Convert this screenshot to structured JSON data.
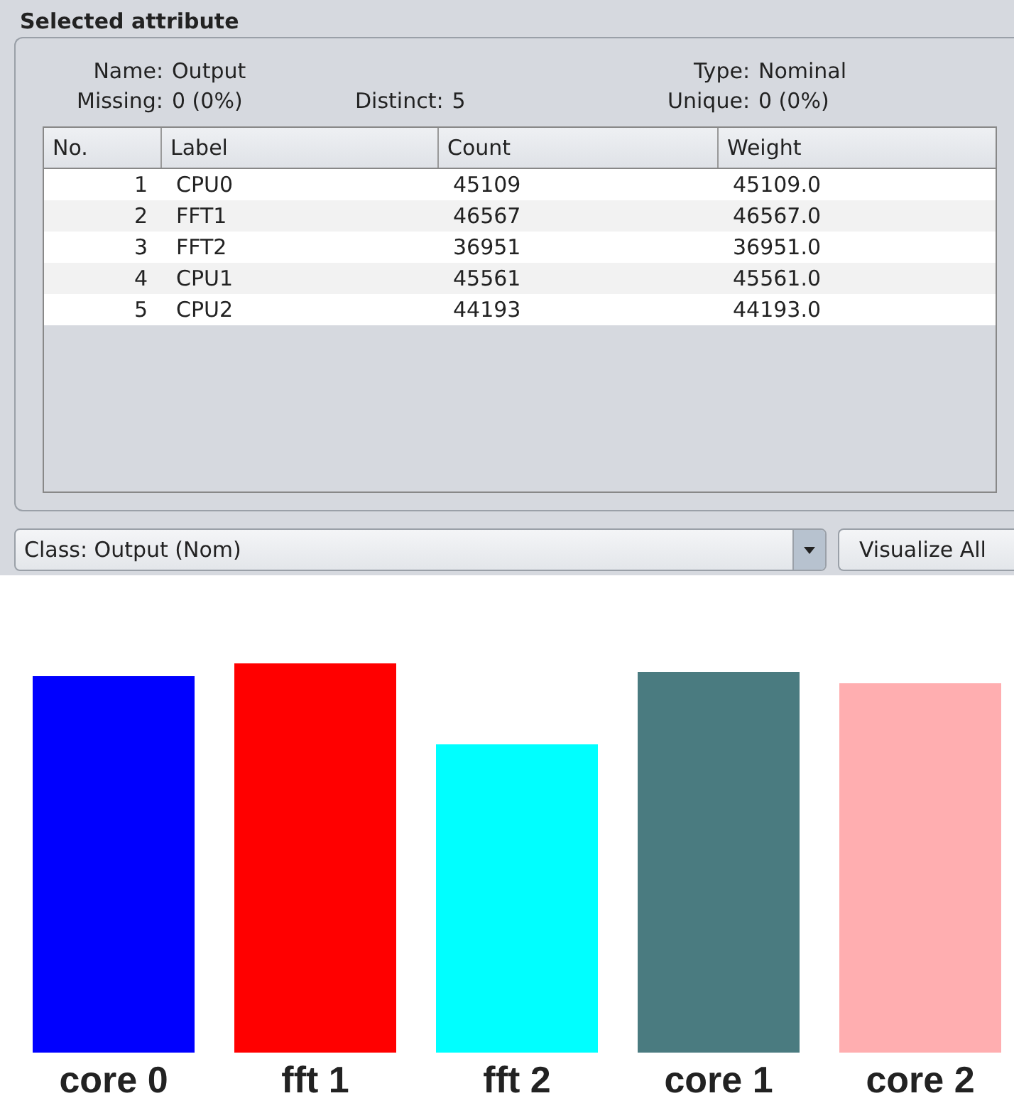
{
  "panel": {
    "title": "Selected attribute",
    "info": [
      {
        "label": "Name:",
        "value": "Output"
      },
      {
        "label": "Type:",
        "value": "Nominal"
      },
      {
        "label": "Missing:",
        "value": "0 (0%)"
      },
      {
        "label": "Distinct:",
        "value": "5"
      },
      {
        "label": "Unique:",
        "value": "0 (0%)"
      }
    ],
    "table": {
      "columns": [
        "No.",
        "Label",
        "Count",
        "Weight"
      ],
      "rows": [
        {
          "no": "1",
          "label": "CPU0",
          "count": "45109",
          "weight": "45109.0"
        },
        {
          "no": "2",
          "label": "FFT1",
          "count": "46567",
          "weight": "46567.0"
        },
        {
          "no": "3",
          "label": "FFT2",
          "count": "36951",
          "weight": "36951.0"
        },
        {
          "no": "4",
          "label": "CPU1",
          "count": "45561",
          "weight": "45561.0"
        },
        {
          "no": "5",
          "label": "CPU2",
          "count": "44193",
          "weight": "44193.0"
        }
      ]
    }
  },
  "class_select": {
    "value": "Class: Output (Nom)"
  },
  "visualize_button": "Visualize All",
  "histogram": {
    "bars": [
      {
        "label": "core 0",
        "color": "#0000ff"
      },
      {
        "label": "fft 1",
        "color": "#ff0000"
      },
      {
        "label": "fft 2",
        "color": "#00ffff"
      },
      {
        "label": "core 1",
        "color": "#4a7b80"
      },
      {
        "label": "core 2",
        "color": "#ffaeb0"
      }
    ]
  }
}
